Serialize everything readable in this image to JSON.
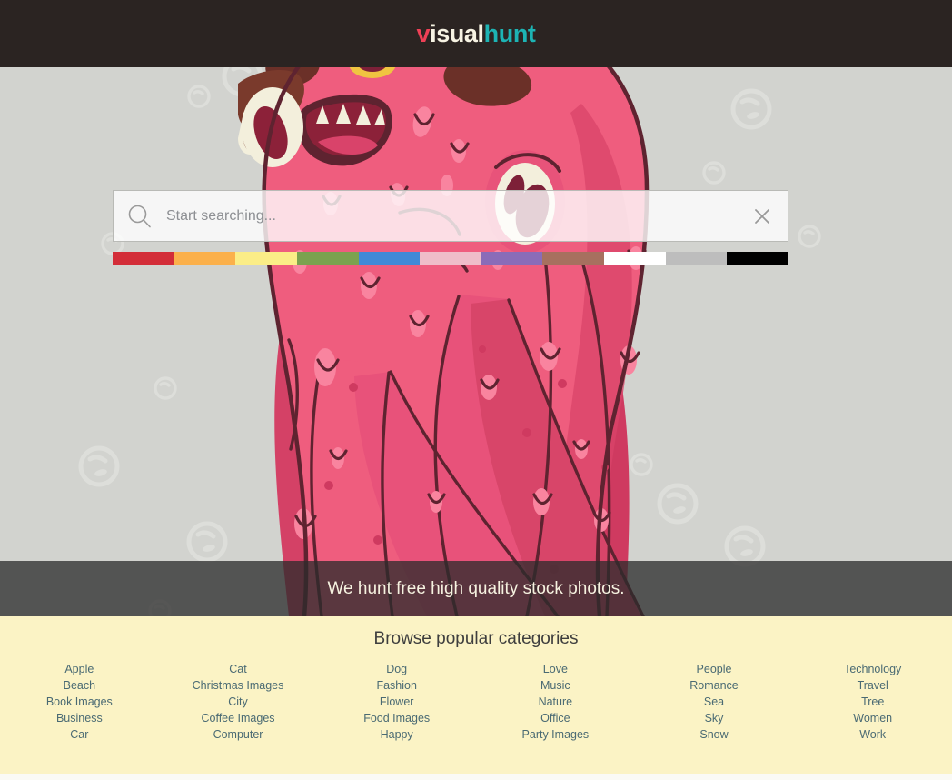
{
  "header": {
    "logo_part_1": "v",
    "logo_part_2": "isual",
    "logo_part_3": "hunt",
    "brand_red": "#ef4056",
    "brand_cream": "#f7f3e3",
    "brand_teal": "#1db4b4",
    "bar_color": "#2b2422"
  },
  "search": {
    "placeholder": "Start searching...",
    "value": "",
    "search_icon": "magnifier-icon",
    "clear_icon": "close-x-icon"
  },
  "color_filters": [
    {
      "name": "red",
      "hex": "#d32d38"
    },
    {
      "name": "orange",
      "hex": "#fbb04b"
    },
    {
      "name": "yellow",
      "hex": "#fbed87"
    },
    {
      "name": "green",
      "hex": "#7ba24f"
    },
    {
      "name": "blue",
      "hex": "#4189d6"
    },
    {
      "name": "pink",
      "hex": "#efbdc9"
    },
    {
      "name": "purple",
      "hex": "#8a6cb8"
    },
    {
      "name": "brown",
      "hex": "#a7705f"
    },
    {
      "name": "white",
      "hex": "#ffffff"
    },
    {
      "name": "gray",
      "hex": "#bdbdbd"
    },
    {
      "name": "black",
      "hex": "#000000"
    }
  ],
  "tagline": {
    "text": "We hunt free high quality stock photos."
  },
  "categories": {
    "title": "Browse popular categories",
    "columns": [
      {
        "items": [
          "Apple",
          "Beach",
          "Book Images",
          "Business",
          "Car"
        ]
      },
      {
        "items": [
          "Cat",
          "Christmas Images",
          "City",
          "Coffee Images",
          "Computer"
        ]
      },
      {
        "items": [
          "Dog",
          "Fashion",
          "Flower",
          "Food Images",
          "Happy"
        ]
      },
      {
        "items": [
          "Love",
          "Music",
          "Nature",
          "Office",
          "Party Images"
        ]
      },
      {
        "items": [
          "People",
          "Romance",
          "Sea",
          "Sky",
          "Snow"
        ]
      },
      {
        "items": [
          "Technology",
          "Travel",
          "Tree",
          "Women",
          "Work"
        ]
      }
    ]
  },
  "hero": {
    "background_color": "#d2d3cf",
    "illustration": "pink-monster-octopus-illustration",
    "monster_body": "#ef5d7e",
    "monster_shadow": "#cf3a60",
    "monster_outline": "#5e2330",
    "monster_highlight": "#f97e9b",
    "bubble_color": "#dcddd8"
  },
  "page_background": "#fafaf5"
}
